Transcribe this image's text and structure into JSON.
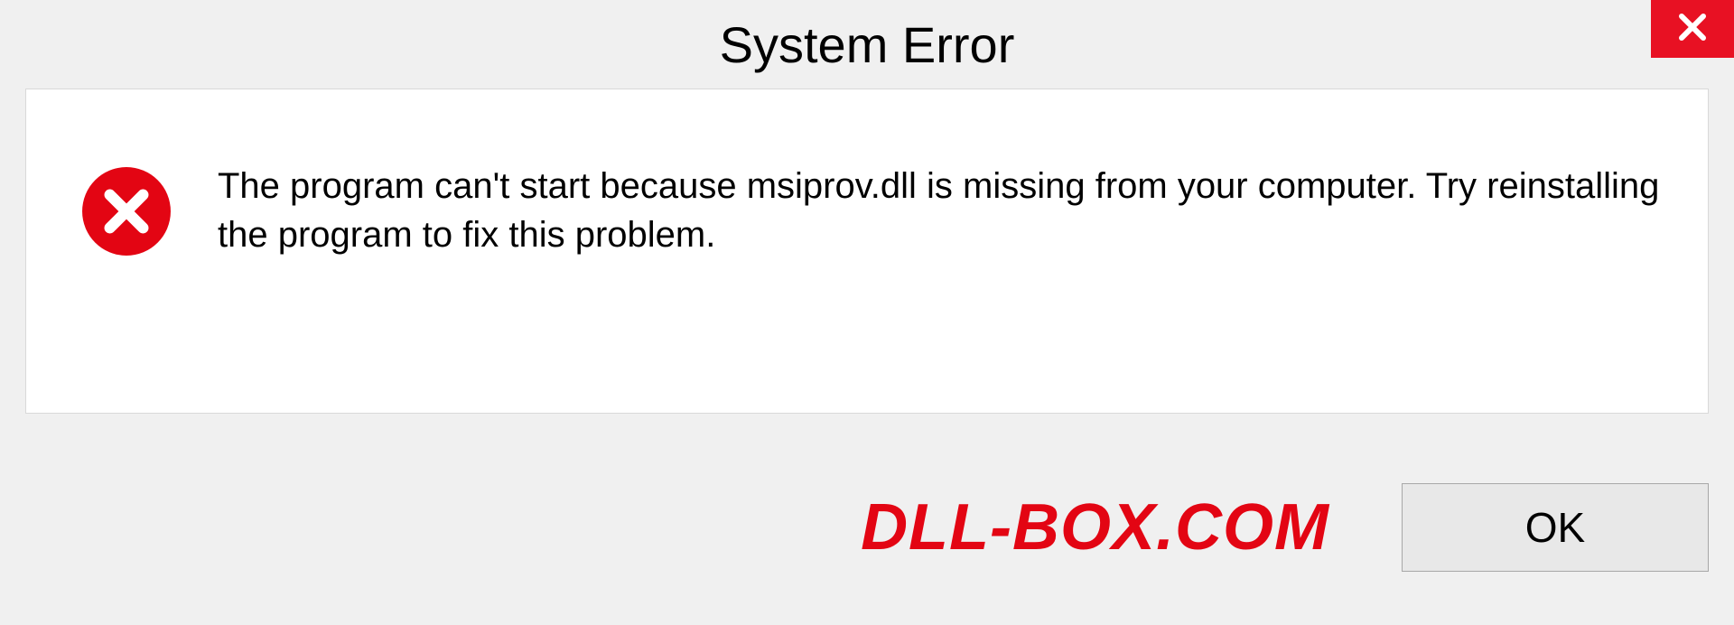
{
  "dialog": {
    "title": "System Error",
    "message": "The program can't start because msiprov.dll is missing from your computer. Try reinstalling the program to fix this problem.",
    "ok_label": "OK"
  },
  "watermark": "DLL-BOX.COM"
}
